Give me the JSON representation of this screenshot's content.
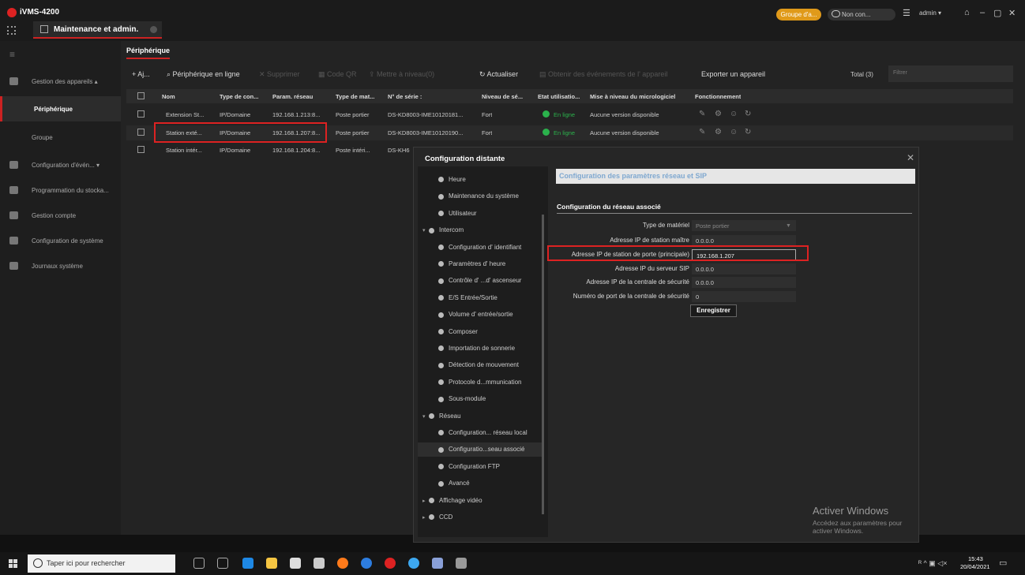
{
  "app": {
    "title": "iVMS-4200",
    "tab_label": "Maintenance et admin.",
    "group_badge": "Groupe d'a...",
    "cloud_badge": "Non con...",
    "user": "admin ▾"
  },
  "sidebar": {
    "items": [
      {
        "label": "Gestion des appareils ▴"
      },
      {
        "label": "Périphérique"
      },
      {
        "label": "Groupe"
      },
      {
        "label": "Configuration d'évén... ▾"
      },
      {
        "label": "Programmation du stocka..."
      },
      {
        "label": "Gestion compte"
      },
      {
        "label": "Configuration de système"
      },
      {
        "label": "Journaux système"
      }
    ]
  },
  "page_tab": "Périphérique",
  "toolbar": {
    "add": "+ Aj...",
    "online": "Périphérique en ligne",
    "delete": "✕ Supprimer",
    "qr": "Code QR",
    "upgrade": "Mettre à niveau(0)",
    "refresh": "↻ Actualiser",
    "get_events": "Obtenir des événements de l' appareil",
    "export": "Exporter un appareil",
    "total": "Total (3)",
    "filter_placeholder": "Filtrer"
  },
  "table": {
    "headers": [
      "Nom",
      "Type de con...",
      "Param. réseau",
      "Type de mat...",
      "N° de série :",
      "Niveau de sé...",
      "Etat utilisatio...",
      "Mise à niveau du micrologiciel",
      "Fonctionnement"
    ],
    "rows": [
      {
        "name": "Extension St...",
        "conn": "IP/Domaine",
        "net": "192.168.1.213:8...",
        "type": "Poste portier",
        "serial": "DS-KD8003-IME10120181...",
        "level": "Fort",
        "status": "En ligne",
        "fw": "Aucune version disponible"
      },
      {
        "name": "Station exté...",
        "conn": "IP/Domaine",
        "net": "192.168.1.207:8...",
        "type": "Poste portier",
        "serial": "DS-KD8003-IME10120190...",
        "level": "Fort",
        "status": "En ligne",
        "fw": "Aucune version disponible"
      },
      {
        "name": "Station intér...",
        "conn": "IP/Domaine",
        "net": "192.168.1.204:8...",
        "type": "Poste intéri...",
        "serial": "DS-KH6",
        "level": "",
        "status": "",
        "fw": ""
      }
    ]
  },
  "dialog": {
    "title": "Configuration distante",
    "tree": [
      {
        "label": "Heure",
        "level": 1
      },
      {
        "label": "Maintenance du système",
        "level": 1
      },
      {
        "label": "Utilisateur",
        "level": 1
      },
      {
        "label": "Intercom",
        "level": 0
      },
      {
        "label": "Configuration d' identifiant",
        "level": 1
      },
      {
        "label": "Paramètres d' heure",
        "level": 1
      },
      {
        "label": "Contrôle d' ...d' ascenseur",
        "level": 1
      },
      {
        "label": "E/S Entrée/Sortie",
        "level": 1
      },
      {
        "label": "Volume d' entrée/sortie",
        "level": 1
      },
      {
        "label": "Composer",
        "level": 1
      },
      {
        "label": "Importation de sonnerie",
        "level": 1
      },
      {
        "label": "Détection de mouvement",
        "level": 1
      },
      {
        "label": "Protocole d...mmunication",
        "level": 1
      },
      {
        "label": "Sous-module",
        "level": 1
      },
      {
        "label": "Réseau",
        "level": 0
      },
      {
        "label": "Configuration... réseau local",
        "level": 1
      },
      {
        "label": "Configuratio...seau associé",
        "level": 1
      },
      {
        "label": "Configuration FTP",
        "level": 1
      },
      {
        "label": "Avancé",
        "level": 1
      },
      {
        "label": "Affichage vidéo",
        "level": 0
      },
      {
        "label": "CCD",
        "level": 0
      }
    ],
    "panel_header": "Configuration des paramètres réseau et SIP",
    "section_title": "Configuration du réseau associé",
    "fields": [
      {
        "label": "Type de matériel",
        "value": "Poste portier"
      },
      {
        "label": "Adresse IP de station maître",
        "value": "0.0.0.0"
      },
      {
        "label": "Adresse IP de station de porte (principale)",
        "value": "192.168.1.207"
      },
      {
        "label": "Adresse IP du serveur SIP",
        "value": "0.0.0.0"
      },
      {
        "label": "Adresse IP de la centrale de sécurité",
        "value": "0.0.0.0"
      },
      {
        "label": "Numéro de port de la centrale de sécurité",
        "value": "0"
      }
    ],
    "save": "Enregistrer",
    "watermark_title": "Activer Windows",
    "watermark_sub": "Accédez aux paramètres pour activer Windows."
  },
  "taskbar": {
    "search_placeholder": "Taper ici pour rechercher",
    "time": "15:43",
    "date": "20/04/2021"
  },
  "colors": {
    "accent": "#cc2222",
    "online": "#2bb24c",
    "badge": "#e09a1a"
  }
}
